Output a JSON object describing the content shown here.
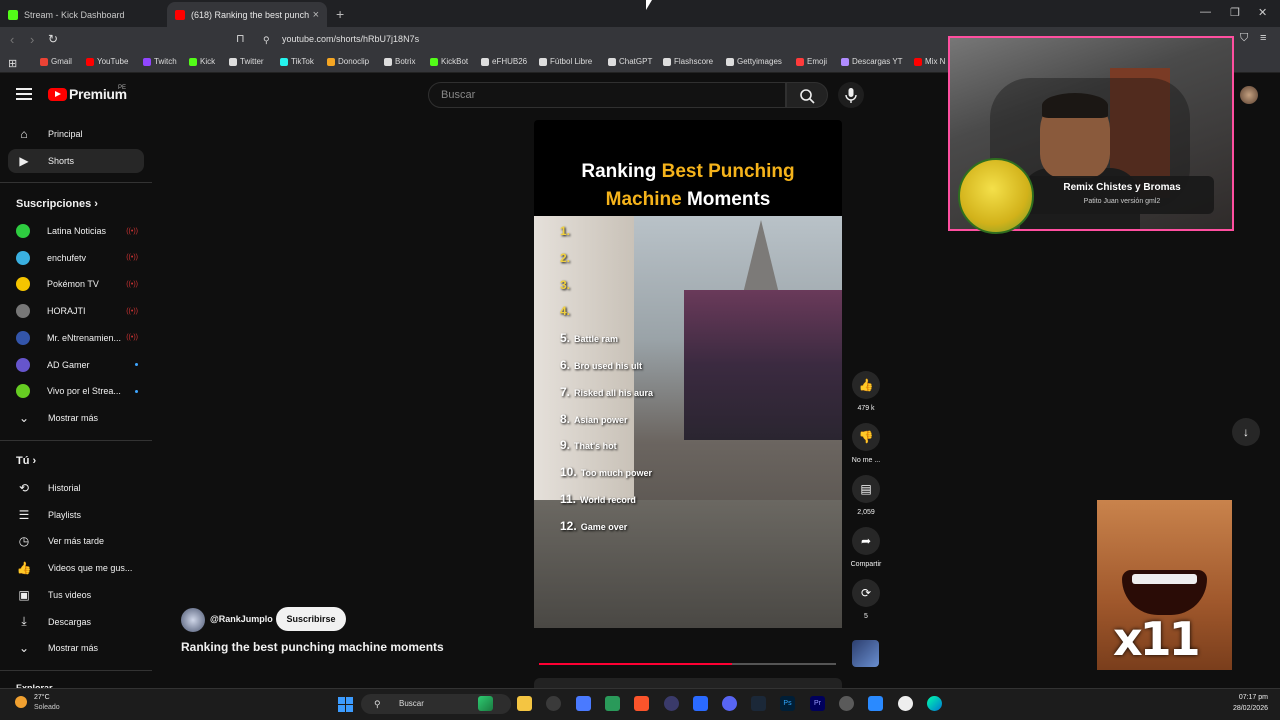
{
  "browser": {
    "tabs": [
      {
        "title": "Stream - Kick Dashboard",
        "color": "#53fc18"
      },
      {
        "title": "(618) Ranking the best punch",
        "color": "#ff0000"
      }
    ],
    "url": "youtube.com/shorts/hRbU7j18N7s",
    "bookmarks": [
      {
        "label": "Gmail",
        "color": "#ea4335"
      },
      {
        "label": "YouTube",
        "color": "#ff0000"
      },
      {
        "label": "Twitch",
        "color": "#9146ff"
      },
      {
        "label": "Kick",
        "color": "#53fc18"
      },
      {
        "label": "Twitter",
        "color": "#dddddd"
      },
      {
        "label": "TikTok",
        "color": "#25f4ee"
      },
      {
        "label": "Donoclip",
        "color": "#f5a623"
      },
      {
        "label": "Botrix",
        "color": "#dddddd"
      },
      {
        "label": "KickBot",
        "color": "#53fc18"
      },
      {
        "label": "eFHUB26",
        "color": "#dddddd"
      },
      {
        "label": "Fútbol Libre",
        "color": "#dddddd"
      },
      {
        "label": "ChatGPT",
        "color": "#dddddd"
      },
      {
        "label": "Flashscore",
        "color": "#dddddd"
      },
      {
        "label": "Gettyimages",
        "color": "#dddddd"
      },
      {
        "label": "Emoji",
        "color": "#ff3b3b"
      },
      {
        "label": "Descargas YT",
        "color": "#b08cff"
      },
      {
        "label": "Mix N",
        "color": "#ff0000"
      }
    ]
  },
  "youtube": {
    "logo": "Premium",
    "region": "PE",
    "search_placeholder": "Buscar",
    "nav": [
      {
        "label": "Principal",
        "icon": "home-icon"
      },
      {
        "label": "Shorts",
        "icon": "shorts-icon"
      }
    ],
    "subscriptions_title": "Suscripciones",
    "subscriptions": [
      {
        "name": "Latina Noticias",
        "status": "live",
        "color": "#2ecc40"
      },
      {
        "name": "enchufetv",
        "status": "live",
        "color": "#3ab0e0"
      },
      {
        "name": "Pokémon TV",
        "status": "live",
        "color": "#f5c400"
      },
      {
        "name": "HORAJTI",
        "status": "live",
        "color": "#777777"
      },
      {
        "name": "Mr. eNtrenamien...",
        "status": "live",
        "color": "#3355aa"
      },
      {
        "name": "AD Gamer",
        "status": "new",
        "color": "#6655cc"
      },
      {
        "name": "Vivo por el Strea...",
        "status": "new",
        "color": "#66cc22"
      }
    ],
    "show_more": "Mostrar más",
    "you_title": "Tú",
    "you_items": [
      {
        "label": "Historial",
        "icon": "history-icon"
      },
      {
        "label": "Playlists",
        "icon": "playlist-icon"
      },
      {
        "label": "Ver más tarde",
        "icon": "clock-icon"
      },
      {
        "label": "Videos que me gus...",
        "icon": "like-icon"
      },
      {
        "label": "Tus videos",
        "icon": "video-icon"
      },
      {
        "label": "Descargas",
        "icon": "download-icon"
      }
    ],
    "show_more_2": "Mostrar más",
    "explore_title": "Explorar"
  },
  "short": {
    "title_white_1": "Ranking ",
    "title_yellow_1": "Best Punching",
    "title_yellow_2": "Machine",
    "title_white_2": " Moments",
    "ranking": [
      {
        "n": "1.",
        "text": ""
      },
      {
        "n": "2.",
        "text": ""
      },
      {
        "n": "3.",
        "text": ""
      },
      {
        "n": "4.",
        "text": ""
      },
      {
        "n": "5.",
        "text": "Battle ram"
      },
      {
        "n": "6.",
        "text": "Bro used his ult"
      },
      {
        "n": "7.",
        "text": "Risked all his aura"
      },
      {
        "n": "8.",
        "text": "Asian power"
      },
      {
        "n": "9.",
        "text": "That's hot"
      },
      {
        "n": "10.",
        "text": "Too much power"
      },
      {
        "n": "11.",
        "text": "World record"
      },
      {
        "n": "12.",
        "text": "Game over"
      }
    ],
    "progress_fraction": 0.65,
    "likes": "479 k",
    "dislike_label": "No me ...",
    "comments": "2,059",
    "share_label": "Compartir",
    "remix_count": "5",
    "channel": "@RankJumplo",
    "subscribe": "Suscribirse",
    "video_title": "Ranking the best punching machine moments"
  },
  "overlay": {
    "remix_title": "Remix Chistes y Bromas",
    "remix_sub": "Patito Juan versión gml2",
    "meme_text": "x11"
  },
  "taskbar": {
    "temperature": "27°C",
    "weather": "Soleado",
    "search": "Buscar",
    "time": "07:17 pm",
    "date": "28/02/2026"
  }
}
